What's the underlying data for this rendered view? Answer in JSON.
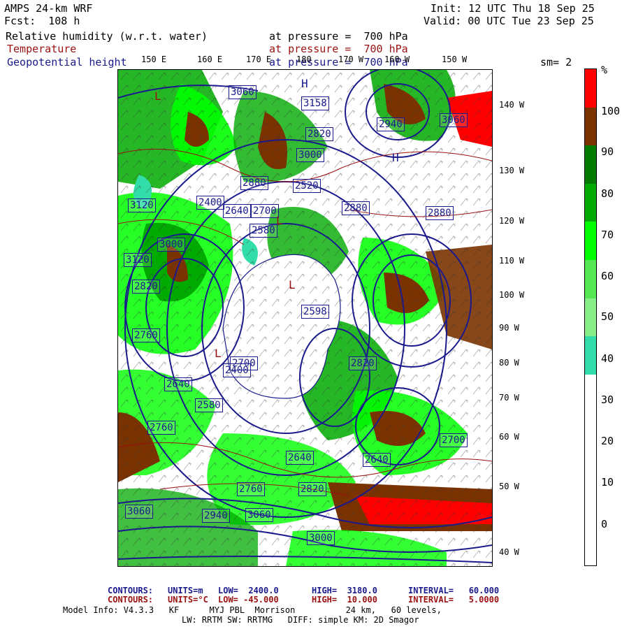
{
  "header": {
    "model": "AMPS 24-km WRF",
    "forecast": "Fcst:  108 h",
    "init": "Init: 12 UTC Thu 18 Sep 25",
    "valid": "Valid: 00 UTC Tue 23 Sep 25"
  },
  "fields": [
    {
      "name": "Relative humidity (w.r.t. water)",
      "level": "at pressure =  700 hPa",
      "color": "#000000"
    },
    {
      "name": "Temperature",
      "level": "at pressure =  700 hPa",
      "color": "#9a1010"
    },
    {
      "name": "Geopotential height",
      "level": "at pressure =  700 hPa",
      "color": "#1a1a8c"
    }
  ],
  "smoothing": "sm= 2",
  "colorbar": {
    "unit": "%",
    "labels": [
      "100",
      "90",
      "80",
      "70",
      "60",
      "50",
      "40",
      "30",
      "20",
      "10",
      "0"
    ],
    "colors": [
      "#ff0000",
      "#7a3300",
      "#007a00",
      "#00aa00",
      "#00ff00",
      "#55e855",
      "#88ee88",
      "#33ddaa",
      "#ffffff",
      "#ffffff",
      "#ffffff",
      "#ffffff",
      "#ffffff"
    ]
  },
  "lon_labels": [
    "150 E",
    "160 E",
    "170 E",
    "180",
    "170 W",
    "160 W",
    "150 W"
  ],
  "lat_labels": [
    "140 W",
    "130 W",
    "120 W",
    "110 W",
    "100 W",
    "90 W",
    "80 W",
    "70 W",
    "60 W",
    "50 W",
    "40 W"
  ],
  "height_labels": [
    "3060",
    "3158",
    "3000",
    "2820",
    "2940",
    "3060",
    "2700",
    "2580",
    "2640",
    "2400",
    "2520",
    "2598",
    "2880",
    "3120",
    "3000",
    "3120",
    "2820",
    "2760",
    "2700",
    "2640",
    "2580",
    "2820",
    "2760",
    "2640",
    "3060",
    "2940",
    "3060",
    "3000",
    "2880",
    "2400",
    "2700",
    "2640",
    "2760",
    "2820",
    "2880"
  ],
  "pressure_centers": [
    "H",
    "H",
    "L",
    "L",
    "L",
    "L"
  ],
  "footer": {
    "row1": {
      "contours": "CONTOURS:",
      "units": "UNITS=m",
      "low": "LOW=  2400.0",
      "high": "HIGH=  3180.0",
      "interval": "INTERVAL=   60.000"
    },
    "row2": {
      "contours": "CONTOURS:",
      "units": "UNITS=°C",
      "low": "LOW= -45.000",
      "high": "HIGH=  10.000",
      "interval": "INTERVAL=   5.0000"
    },
    "model_info": "Model Info: V4.3.3   KF      MYJ PBL  Morrison          24 km,   60 levels,",
    "model_info2": "LW: RRTM SW: RRTMG   DIFF: simple KM: 2D Smagor"
  }
}
